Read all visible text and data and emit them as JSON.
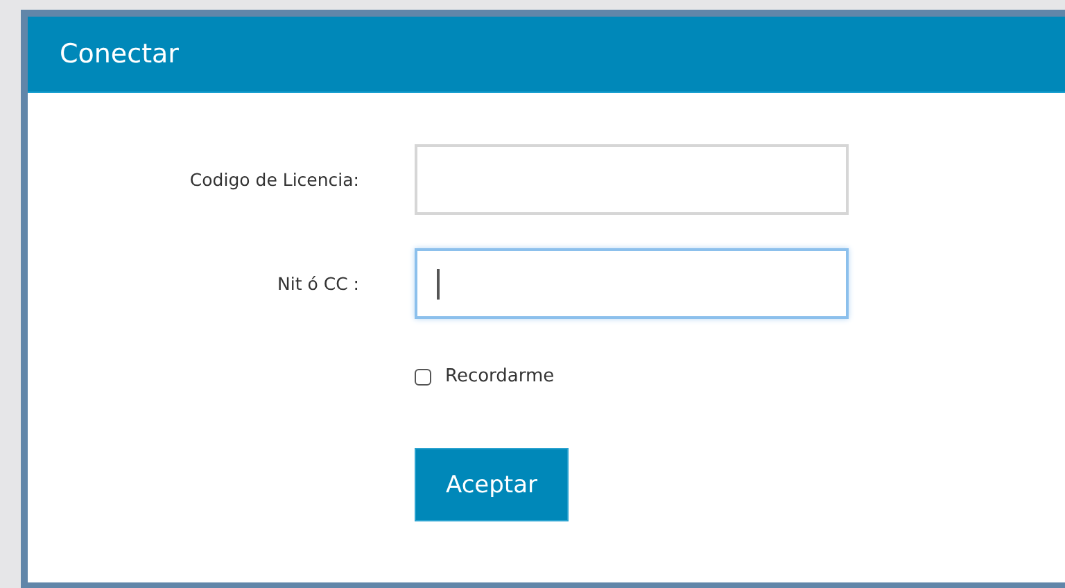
{
  "dialog": {
    "title": "Conectar"
  },
  "fields": [
    {
      "label": "Codigo de Licencia:",
      "focused": false
    },
    {
      "label": "Nit ó CC :",
      "focused": true
    }
  ],
  "remember": {
    "label": "Recordarme",
    "checked": false
  },
  "buttons": [
    "Aceptar"
  ]
}
